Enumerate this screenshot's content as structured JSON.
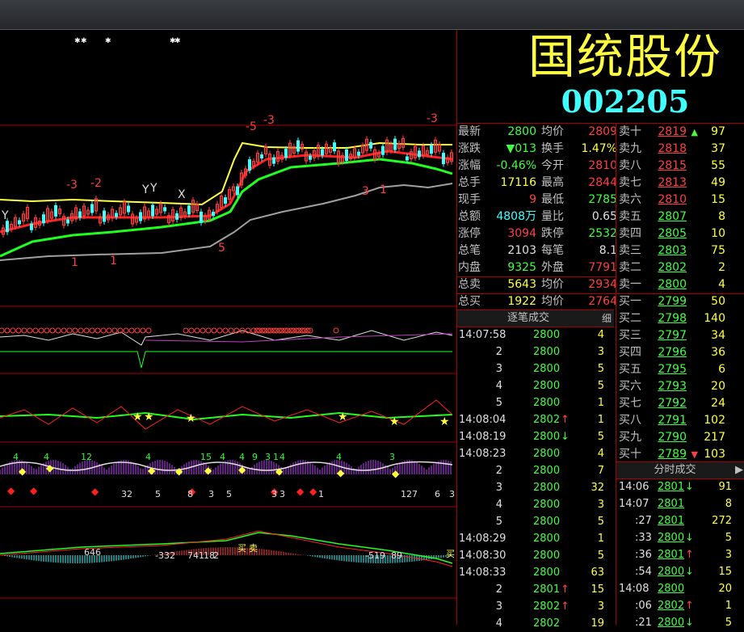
{
  "stock": {
    "name": "国统股份",
    "code": "002205"
  },
  "quote_left": [
    {
      "label": "最新",
      "value": "2800",
      "cls": "down"
    },
    {
      "label": "涨跌",
      "value": "▼013",
      "cls": "down"
    },
    {
      "label": "涨幅",
      "value": "-0.46%",
      "cls": "down"
    },
    {
      "label": "总手",
      "value": "17116",
      "cls": "yellow"
    },
    {
      "label": "现手",
      "value": "9",
      "cls": "up"
    },
    {
      "label": "总额",
      "value": "4808万",
      "cls": "cyan"
    },
    {
      "label": "涨停",
      "value": "3094",
      "cls": "up"
    },
    {
      "label": "总笔",
      "value": "2103",
      "cls": "white"
    },
    {
      "label": "内盘",
      "value": "9325",
      "cls": "down"
    },
    {
      "label": "总卖",
      "value": "5643",
      "cls": "yellow"
    },
    {
      "label": "总买",
      "value": "1922",
      "cls": "yellow"
    }
  ],
  "quote_mid": [
    {
      "label": "均价",
      "value": "2809",
      "cls": "up"
    },
    {
      "label": "换手",
      "value": "1.47%",
      "cls": "yellow"
    },
    {
      "label": "今开",
      "value": "2810",
      "cls": "up"
    },
    {
      "label": "最高",
      "value": "2844",
      "cls": "up"
    },
    {
      "label": "最低",
      "value": "2785",
      "cls": "down"
    },
    {
      "label": "量比",
      "value": "0.65",
      "cls": "white"
    },
    {
      "label": "跌停",
      "value": "2532",
      "cls": "down"
    },
    {
      "label": "每笔",
      "value": "8.1",
      "cls": "white"
    },
    {
      "label": "外盘",
      "value": "7791",
      "cls": "up"
    },
    {
      "label": "均价",
      "value": "2934",
      "cls": "up"
    },
    {
      "label": "均价",
      "value": "2764",
      "cls": "up"
    }
  ],
  "order_book": [
    {
      "label": "卖十",
      "price": "2819",
      "pcls": "up",
      "mark": "▲",
      "vol": "97"
    },
    {
      "label": "卖九",
      "price": "2818",
      "pcls": "up",
      "mark": "",
      "vol": "37"
    },
    {
      "label": "卖八",
      "price": "2815",
      "pcls": "up",
      "mark": "",
      "vol": "55"
    },
    {
      "label": "卖七",
      "price": "2813",
      "pcls": "up",
      "mark": "",
      "vol": "49"
    },
    {
      "label": "卖六",
      "price": "2810",
      "pcls": "up",
      "mark": "",
      "vol": "15"
    },
    {
      "label": "卖五",
      "price": "2807",
      "pcls": "down",
      "mark": "",
      "vol": "8"
    },
    {
      "label": "卖四",
      "price": "2805",
      "pcls": "down",
      "mark": "",
      "vol": "10"
    },
    {
      "label": "卖三",
      "price": "2803",
      "pcls": "down",
      "mark": "",
      "vol": "75"
    },
    {
      "label": "卖二",
      "price": "2802",
      "pcls": "down",
      "mark": "",
      "vol": "2"
    },
    {
      "label": "卖一",
      "price": "2800",
      "pcls": "down",
      "mark": "",
      "vol": "4"
    },
    {
      "label": "买一",
      "price": "2799",
      "pcls": "down",
      "mark": "",
      "vol": "50"
    },
    {
      "label": "买二",
      "price": "2798",
      "pcls": "down",
      "mark": "",
      "vol": "140"
    },
    {
      "label": "买三",
      "price": "2797",
      "pcls": "down",
      "mark": "",
      "vol": "34"
    },
    {
      "label": "买四",
      "price": "2796",
      "pcls": "down",
      "mark": "",
      "vol": "36"
    },
    {
      "label": "买五",
      "price": "2795",
      "pcls": "down",
      "mark": "",
      "vol": "6"
    },
    {
      "label": "买六",
      "price": "2793",
      "pcls": "down",
      "mark": "",
      "vol": "20"
    },
    {
      "label": "买七",
      "price": "2792",
      "pcls": "down",
      "mark": "",
      "vol": "24"
    },
    {
      "label": "买八",
      "price": "2791",
      "pcls": "down",
      "mark": "",
      "vol": "102"
    },
    {
      "label": "买九",
      "price": "2790",
      "pcls": "down",
      "mark": "",
      "vol": "217"
    },
    {
      "label": "买十",
      "price": "2789",
      "pcls": "down",
      "mark": "▼",
      "vol": "103"
    }
  ],
  "tick_header": {
    "title": "逐笔成交",
    "detail": "细"
  },
  "ticks": [
    {
      "time": "14:07:58",
      "price": "2800",
      "arrow": "",
      "vol": "4"
    },
    {
      "time": "2",
      "price": "2800",
      "arrow": "",
      "vol": "3"
    },
    {
      "time": "3",
      "price": "2800",
      "arrow": "",
      "vol": "5"
    },
    {
      "time": "4",
      "price": "2800",
      "arrow": "",
      "vol": "5"
    },
    {
      "time": "5",
      "price": "2800",
      "arrow": "",
      "vol": "1"
    },
    {
      "time": "14:08:04",
      "price": "2802",
      "arrow": "up",
      "vol": "1"
    },
    {
      "time": "14:08:19",
      "price": "2800",
      "arrow": "down",
      "vol": "5"
    },
    {
      "time": "14:08:23",
      "price": "2800",
      "arrow": "",
      "vol": "4"
    },
    {
      "time": "2",
      "price": "2800",
      "arrow": "",
      "vol": "7"
    },
    {
      "time": "3",
      "price": "2800",
      "arrow": "",
      "vol": "32"
    },
    {
      "time": "4",
      "price": "2800",
      "arrow": "",
      "vol": "3"
    },
    {
      "time": "5",
      "price": "2800",
      "arrow": "",
      "vol": "5"
    },
    {
      "time": "14:08:29",
      "price": "2800",
      "arrow": "",
      "vol": "1"
    },
    {
      "time": "14:08:30",
      "price": "2800",
      "arrow": "",
      "vol": "5"
    },
    {
      "time": "14:08:33",
      "price": "2800",
      "arrow": "",
      "vol": "63"
    },
    {
      "time": "2",
      "price": "2801",
      "arrow": "up",
      "vol": "15"
    },
    {
      "time": "3",
      "price": "2802",
      "arrow": "up",
      "vol": "3"
    },
    {
      "time": "4",
      "price": "2802",
      "arrow": "",
      "vol": "19"
    }
  ],
  "minute_header": {
    "title": "分时成交"
  },
  "minutes": [
    {
      "time": "14:06",
      "price": "2801",
      "arrow": "down",
      "vol": "91"
    },
    {
      "time": "14:07",
      "price": "2801",
      "arrow": "",
      "vol": "8"
    },
    {
      "time": ":27",
      "price": "2801",
      "arrow": "",
      "vol": "272"
    },
    {
      "time": ":33",
      "price": "2800",
      "arrow": "down",
      "vol": "5"
    },
    {
      "time": ":36",
      "price": "2801",
      "arrow": "up",
      "vol": "3"
    },
    {
      "time": ":54",
      "price": "2800",
      "arrow": "down",
      "vol": "15"
    },
    {
      "time": "14:08",
      "price": "2800",
      "arrow": "",
      "vol": "20"
    },
    {
      "time": ":06",
      "price": "2802",
      "arrow": "up",
      "vol": "1"
    },
    {
      "time": ":21",
      "price": "2800",
      "arrow": "down",
      "vol": "5"
    }
  ],
  "chart_labels": {
    "main": [
      "-3",
      "-2",
      "Y",
      "Y",
      "X",
      "5",
      "-5",
      "-3",
      "-3",
      "3",
      "1",
      "1",
      "1",
      "Y"
    ],
    "indicator3_numbers": [
      "4",
      "4",
      "12",
      "4",
      "15",
      "4",
      "4",
      "9",
      "3",
      "1",
      "4",
      "4",
      "3",
      "32",
      "5",
      "8",
      "3",
      "5",
      "3",
      "3",
      "1",
      "12",
      "7",
      "6",
      "3"
    ],
    "indicator4_labels": [
      "646",
      "-332",
      "741",
      "18",
      "2",
      "-519",
      "89",
      "买",
      "卖",
      "买"
    ]
  },
  "colors": {
    "up": "#ff4040",
    "down": "#40ff40",
    "ma_yellow": "#ffff40",
    "ma_red": "#ff2020",
    "ma_green": "#20ff20",
    "ma_gray": "#a0a0a0"
  }
}
